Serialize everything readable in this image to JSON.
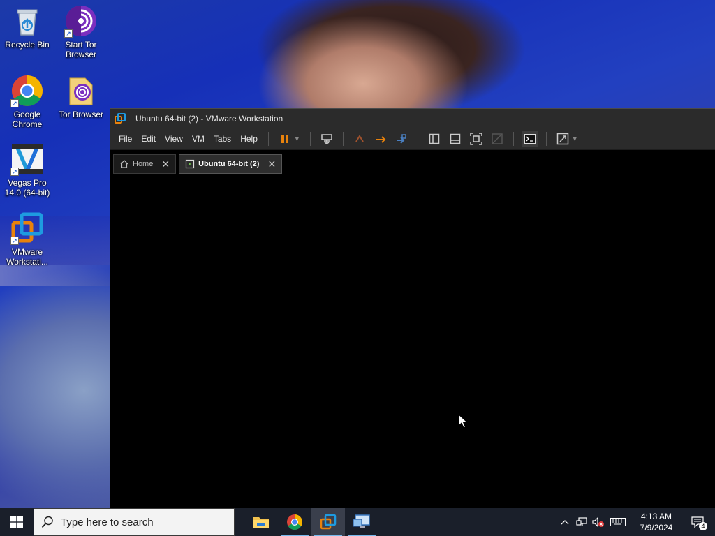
{
  "desktop": {
    "icons": [
      {
        "label": "Recycle Bin",
        "icon": "recycle-bin-icon"
      },
      {
        "label": "Start Tor Browser",
        "icon": "tor-browser-icon"
      },
      {
        "label": "Google Chrome",
        "icon": "chrome-icon"
      },
      {
        "label": "Tor Browser",
        "icon": "tor-folder-icon"
      },
      {
        "label": "Vegas Pro 14.0 (64-bit)",
        "icon": "vegas-pro-icon"
      },
      {
        "label": "VMware Workstati...",
        "icon": "vmware-icon"
      }
    ]
  },
  "window": {
    "title": "Ubuntu 64-bit (2) - VMware Workstation",
    "menu": [
      "File",
      "Edit",
      "View",
      "VM",
      "Tabs",
      "Help"
    ],
    "tabs": [
      {
        "label": "Home",
        "close": "✕"
      },
      {
        "label": "Ubuntu 64-bit (2)",
        "close": "✕"
      }
    ]
  },
  "taskbar": {
    "search_placeholder": "Type here to search",
    "time": "4:13 AM",
    "date": "7/9/2024",
    "notification_count": "4"
  },
  "colors": {
    "accent_orange": "#e8820c",
    "vmware_blue": "#1e9be0",
    "taskbar_bg": "#1a1f2a"
  }
}
